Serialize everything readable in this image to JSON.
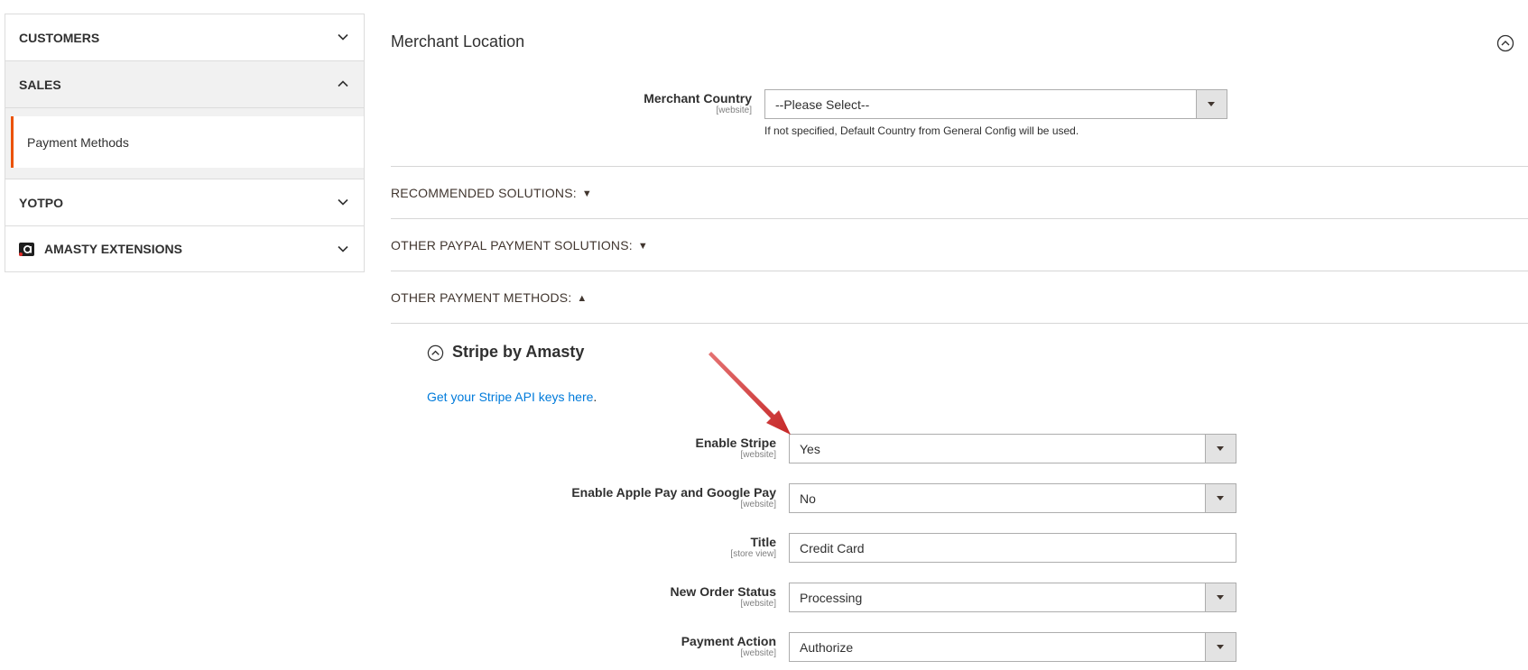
{
  "sidebar": {
    "customers": "CUSTOMERS",
    "sales": "SALES",
    "payment_methods": "Payment Methods",
    "yotpo": "YOTPO",
    "amasty": "AMASTY EXTENSIONS"
  },
  "merchant": {
    "title": "Merchant Location",
    "country_label": "Merchant Country",
    "country_scope": "[website]",
    "country_value": "--Please Select--",
    "country_note": "If not specified, Default Country from General Config will be used."
  },
  "groups": {
    "recommended": "RECOMMENDED SOLUTIONS:",
    "recommended_arrow": "▼",
    "other_paypal": "OTHER PAYPAL PAYMENT SOLUTIONS:",
    "other_paypal_arrow": "▼",
    "other_methods": "OTHER PAYMENT METHODS:",
    "other_methods_arrow": "▲"
  },
  "stripe": {
    "title": "Stripe by Amasty",
    "api_link": "Get your Stripe API keys here",
    "api_link_suffix": ".",
    "fields": [
      {
        "label": "Enable Stripe",
        "scope": "[website]",
        "value": "Yes"
      },
      {
        "label": "Enable Apple Pay and Google Pay",
        "scope": "[website]",
        "value": "No"
      },
      {
        "label": "Title",
        "scope": "[store view]",
        "value": "Credit Card"
      },
      {
        "label": "New Order Status",
        "scope": "[website]",
        "value": "Processing"
      },
      {
        "label": "Payment Action",
        "scope": "[website]",
        "value": "Authorize"
      }
    ]
  },
  "colors": {
    "active_border": "#eb5202",
    "link": "#007bdb",
    "annotation_arrow": "#d32f2f"
  }
}
